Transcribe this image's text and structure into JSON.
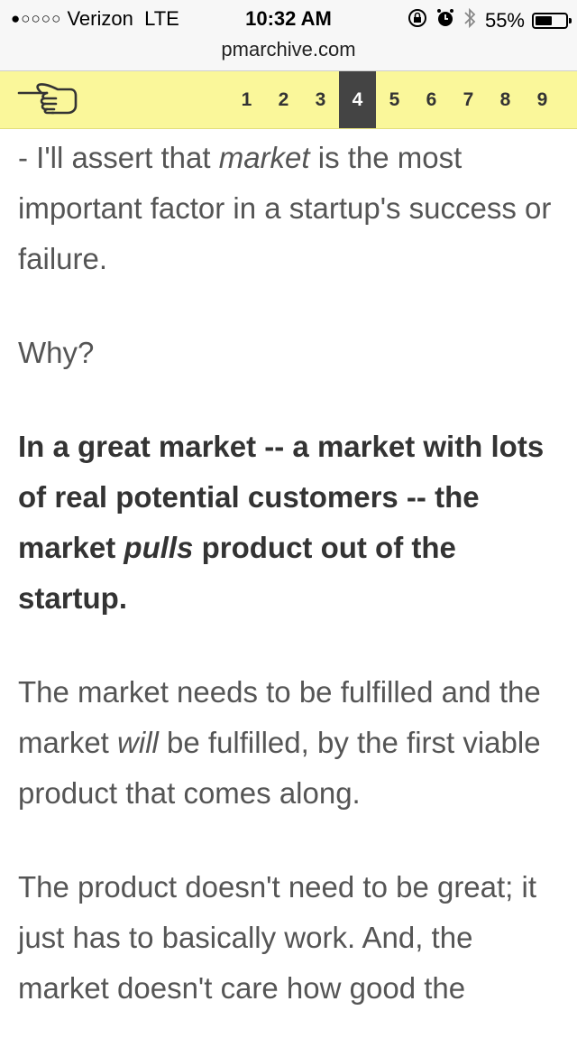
{
  "status_bar": {
    "signal": "●○○○○",
    "carrier": "Verizon",
    "network": "LTE",
    "time": "10:32 AM",
    "battery_percent": "55%",
    "battery_level": 0.55,
    "icons": [
      "orientation-lock-icon",
      "alarm-icon",
      "bluetooth-icon",
      "battery-icon"
    ]
  },
  "browser": {
    "url": "pmarchive.com"
  },
  "nav": {
    "hand_icon": "pointing-hand-icon",
    "pages": [
      "1",
      "2",
      "3",
      "4",
      "5",
      "6",
      "7",
      "8",
      "9"
    ],
    "active_page": "4",
    "highlight_color": "#faf79a"
  },
  "article": {
    "p1": {
      "a": "- I'll assert that ",
      "em": "market",
      "b": " is the most important factor in a startup's success or failure."
    },
    "p2": "Why?",
    "p3": {
      "a": "In a great market -- a market with lots of real potential customers -- the market ",
      "em": "pulls",
      "b": " product out of the startup."
    },
    "p4": {
      "a": "The market needs to be fulfilled and the market ",
      "em": "will",
      "b": " be fulfilled, by the first viable product that comes along."
    },
    "p5": "The product doesn't need to be great; it just has to basically work. And, the market doesn't care how good the"
  }
}
